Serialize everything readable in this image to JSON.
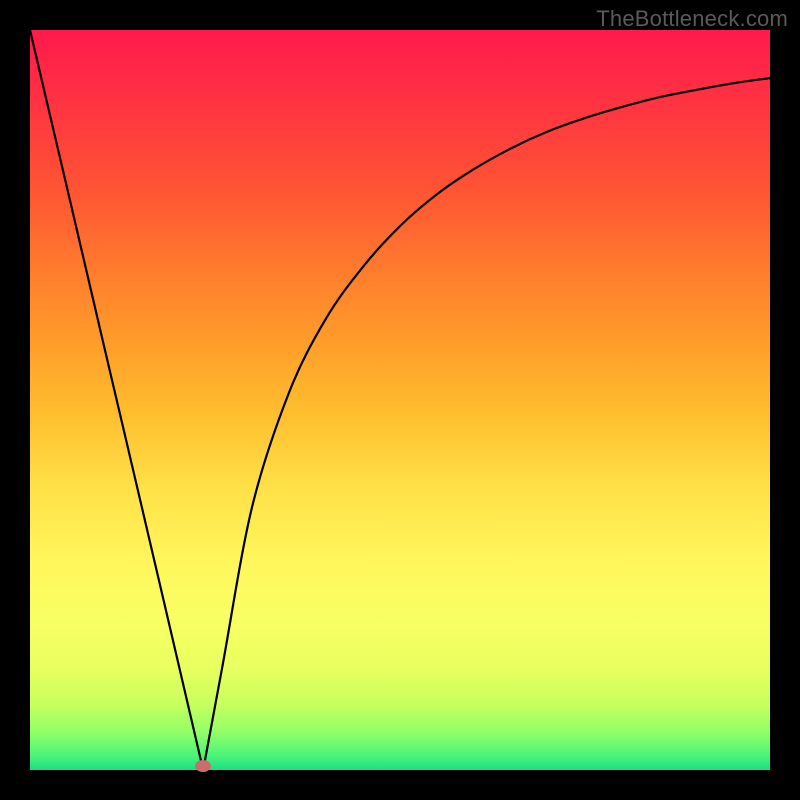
{
  "watermark": "TheBottleneck.com",
  "chart_data": {
    "type": "line",
    "title": "",
    "xlabel": "",
    "ylabel": "",
    "xlim": [
      0,
      1
    ],
    "ylim": [
      0,
      1
    ],
    "series": [
      {
        "name": "curve",
        "x": [
          0.0,
          0.05,
          0.1,
          0.15,
          0.2,
          0.234,
          0.26,
          0.3,
          0.35,
          0.4,
          0.45,
          0.5,
          0.55,
          0.6,
          0.65,
          0.7,
          0.75,
          0.8,
          0.85,
          0.9,
          0.95,
          1.0
        ],
        "values": [
          1.0,
          0.787,
          0.573,
          0.36,
          0.146,
          0.0,
          0.14,
          0.355,
          0.51,
          0.61,
          0.68,
          0.735,
          0.778,
          0.812,
          0.84,
          0.863,
          0.881,
          0.896,
          0.909,
          0.919,
          0.928,
          0.935
        ]
      }
    ],
    "marker": {
      "x": 0.234,
      "y": 0.006
    },
    "gradient_stops": [
      {
        "pos": 0.0,
        "color": "#ff1a4d"
      },
      {
        "pos": 0.22,
        "color": "#ff5533"
      },
      {
        "pos": 0.52,
        "color": "#ffbf2e"
      },
      {
        "pos": 0.8,
        "color": "#f8ff63"
      },
      {
        "pos": 1.0,
        "color": "#1adf86"
      }
    ]
  }
}
